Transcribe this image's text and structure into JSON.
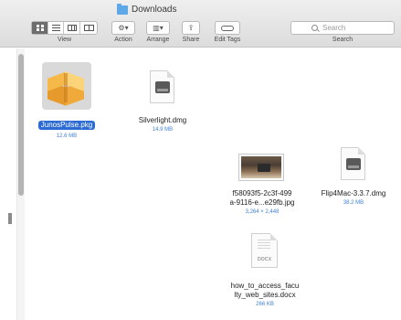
{
  "window": {
    "title": "Downloads"
  },
  "toolbar": {
    "view_label": "View",
    "action_label": "Action",
    "arrange_label": "Arrange",
    "share_label": "Share",
    "edit_tags_label": "Edit Tags",
    "search_label": "Search",
    "search_placeholder": "Search",
    "view_modes": [
      "icon-view",
      "list-view",
      "column-view",
      "cover-flow-view"
    ],
    "active_view": "icon-view"
  },
  "files": [
    {
      "name": "JunosPulse.pkg",
      "size": "12.6 MB",
      "icon": "package-icon",
      "selected": true
    },
    {
      "name": "Silverlight.dmg",
      "size": "14.9 MB",
      "icon": "disk-image-icon",
      "selected": false
    },
    {
      "name_line1": "f58093f5-2c3f-499",
      "name_line2": "a-9116-e...e29fb.jpg",
      "size": "3,264 × 2,448",
      "icon": "photo-thumbnail",
      "selected": false
    },
    {
      "name": "Flip4Mac-3.3.7.dmg",
      "size": "38.2 MB",
      "icon": "disk-image-icon",
      "selected": false
    },
    {
      "name_line1": "how_to_access_facu",
      "name_line2": "lty_web_sites.docx",
      "size": "266 KB",
      "icon": "docx-icon",
      "badge": "DOCX",
      "selected": false
    }
  ],
  "colors": {
    "selection": "#2c6bd3",
    "size_text": "#3f7fd6",
    "folder": "#5fa8e8"
  }
}
